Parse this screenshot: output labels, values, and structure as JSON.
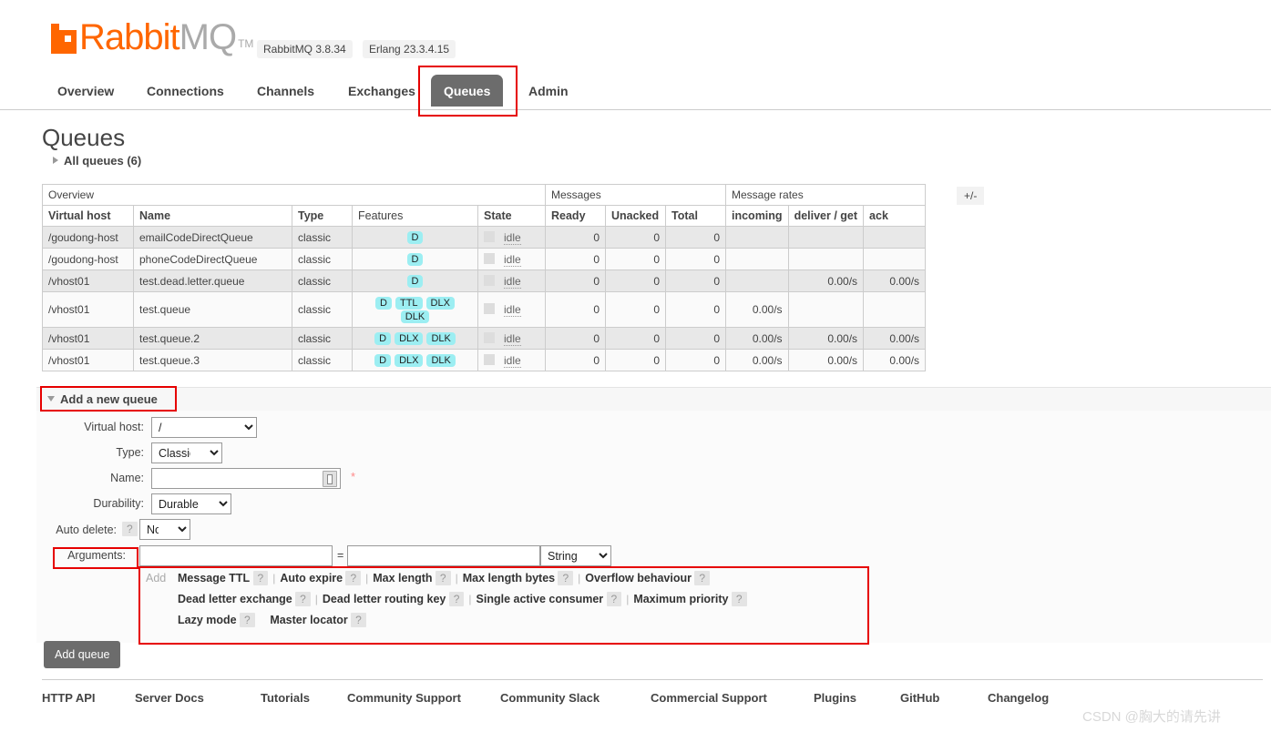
{
  "header": {
    "logo_rabbit": "Rabbit",
    "logo_mq": "MQ",
    "logo_tm": "TM",
    "server_badge": "RabbitMQ 3.8.34",
    "erlang_badge": "Erlang 23.3.4.15"
  },
  "nav": {
    "items": [
      {
        "label": "Overview",
        "active": false
      },
      {
        "label": "Connections",
        "active": false
      },
      {
        "label": "Channels",
        "active": false
      },
      {
        "label": "Exchanges",
        "active": false
      },
      {
        "label": "Queues",
        "active": true
      },
      {
        "label": "Admin",
        "active": false
      }
    ]
  },
  "page": {
    "title": "Queues",
    "all_queues": "All queues (6)"
  },
  "table": {
    "group_headers": {
      "overview": "Overview",
      "messages": "Messages",
      "message_rates": "Message rates"
    },
    "toggle_columns": "+/-",
    "columns": [
      "Virtual host",
      "Name",
      "Type",
      "Features",
      "State",
      "Ready",
      "Unacked",
      "Total",
      "incoming",
      "deliver / get",
      "ack"
    ],
    "state_label": "idle",
    "rows": [
      {
        "vhost": "/goudong-host",
        "name": "emailCodeDirectQueue",
        "type": "classic",
        "features": [
          "D"
        ],
        "state": "idle",
        "ready": "0",
        "unacked": "0",
        "total": "0",
        "incoming": "",
        "deliver_get": "",
        "ack": ""
      },
      {
        "vhost": "/goudong-host",
        "name": "phoneCodeDirectQueue",
        "type": "classic",
        "features": [
          "D"
        ],
        "state": "idle",
        "ready": "0",
        "unacked": "0",
        "total": "0",
        "incoming": "",
        "deliver_get": "",
        "ack": ""
      },
      {
        "vhost": "/vhost01",
        "name": "test.dead.letter.queue",
        "type": "classic",
        "features": [
          "D"
        ],
        "state": "idle",
        "ready": "0",
        "unacked": "0",
        "total": "0",
        "incoming": "",
        "deliver_get": "0.00/s",
        "ack": "0.00/s"
      },
      {
        "vhost": "/vhost01",
        "name": "test.queue",
        "type": "classic",
        "features": [
          "D",
          "TTL",
          "DLX",
          "DLK"
        ],
        "state": "idle",
        "ready": "0",
        "unacked": "0",
        "total": "0",
        "incoming": "0.00/s",
        "deliver_get": "",
        "ack": ""
      },
      {
        "vhost": "/vhost01",
        "name": "test.queue.2",
        "type": "classic",
        "features": [
          "D",
          "DLX",
          "DLK"
        ],
        "state": "idle",
        "ready": "0",
        "unacked": "0",
        "total": "0",
        "incoming": "0.00/s",
        "deliver_get": "0.00/s",
        "ack": "0.00/s"
      },
      {
        "vhost": "/vhost01",
        "name": "test.queue.3",
        "type": "classic",
        "features": [
          "D",
          "DLX",
          "DLK"
        ],
        "state": "idle",
        "ready": "0",
        "unacked": "0",
        "total": "0",
        "incoming": "0.00/s",
        "deliver_get": "0.00/s",
        "ack": "0.00/s"
      }
    ]
  },
  "add_queue": {
    "section_title": "Add a new queue",
    "fields": {
      "vhost_label": "Virtual host:",
      "vhost_value": "/",
      "type_label": "Type:",
      "type_value": "Classic",
      "name_label": "Name:",
      "name_value": "",
      "name_required": "*",
      "durability_label": "Durability:",
      "durability_value": "Durable",
      "autodelete_label": "Auto delete:",
      "autodelete_value": "No",
      "arguments_label": "Arguments:",
      "arg_key_value": "",
      "arg_val_value": "",
      "arg_type_value": "String",
      "equals": "=",
      "help": "?"
    },
    "arguments_presets": {
      "add_label": "Add",
      "rows": [
        [
          "Message TTL",
          "Auto expire",
          "Max length",
          "Max length bytes",
          "Overflow behaviour"
        ],
        [
          "Dead letter exchange",
          "Dead letter routing key",
          "Single active consumer",
          "Maximum priority"
        ],
        [
          "Lazy mode",
          "Master locator"
        ]
      ]
    },
    "submit_label": "Add queue"
  },
  "footer": {
    "links": [
      "HTTP API",
      "Server Docs",
      "Tutorials",
      "Community Support",
      "Community Slack",
      "Commercial Support",
      "Plugins",
      "GitHub",
      "Changelog"
    ]
  },
  "watermark": "CSDN @胸大的请先讲",
  "colors": {
    "brand_orange": "#ff6600",
    "active_tab": "#6c6c6c",
    "feature_badge": "#9ceef2",
    "annotation_red": "#e60000"
  }
}
